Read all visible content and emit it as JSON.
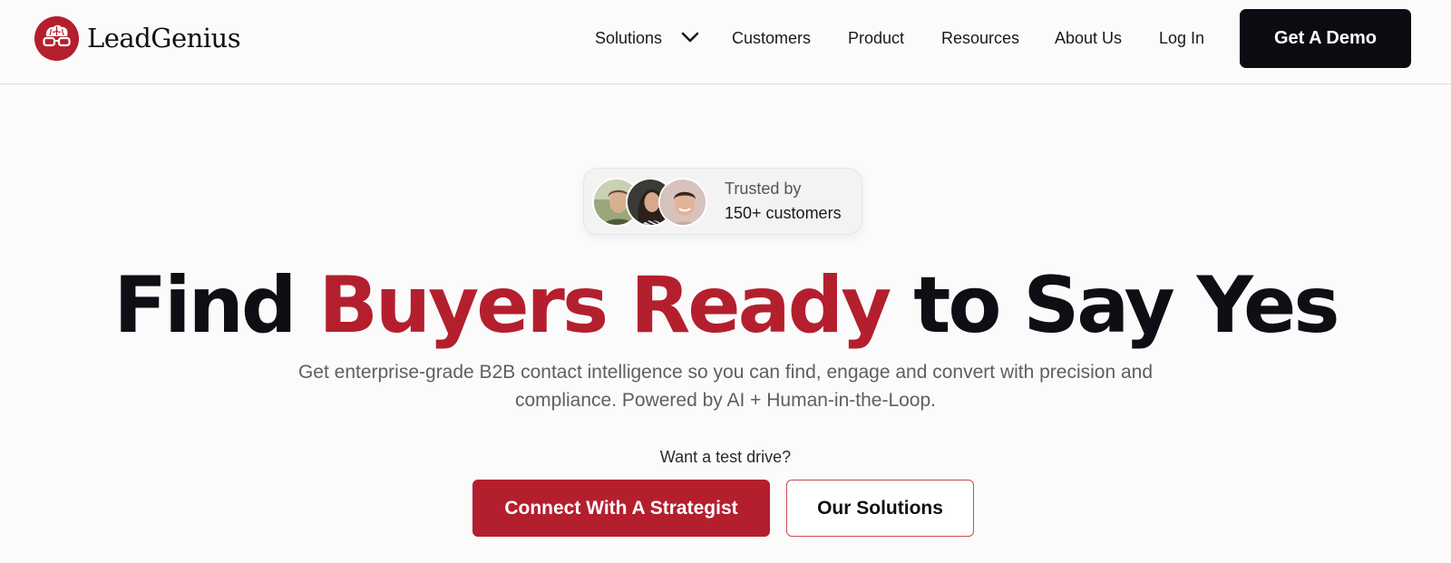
{
  "brand": {
    "name": "LeadGenius",
    "accent_color": "#b41f2e",
    "dark_color": "#0a0c12",
    "logo_icon": "brain-with-glasses-icon"
  },
  "nav": {
    "items": [
      {
        "label": "Solutions",
        "has_dropdown": true
      },
      {
        "label": "Customers"
      },
      {
        "label": "Product"
      },
      {
        "label": "Resources"
      },
      {
        "label": "About Us"
      },
      {
        "label": "Log In"
      }
    ],
    "cta_label": "Get A Demo"
  },
  "trusted": {
    "line1": "Trusted by",
    "line2": "150+ customers",
    "avatars": [
      "customer-avatar-1",
      "customer-avatar-2",
      "customer-avatar-3"
    ]
  },
  "hero": {
    "title_before": "Find ",
    "title_accent": "Buyers Ready",
    "title_after": " to Say Yes",
    "subtitle": "Get enterprise-grade B2B contact intelligence so you can find, engage and convert with precision and compliance. Powered by AI + Human-in-the-Loop.",
    "test_drive_label": "Want a test drive?",
    "primary_cta": "Connect With A Strategist",
    "secondary_cta": "Our Solutions"
  }
}
